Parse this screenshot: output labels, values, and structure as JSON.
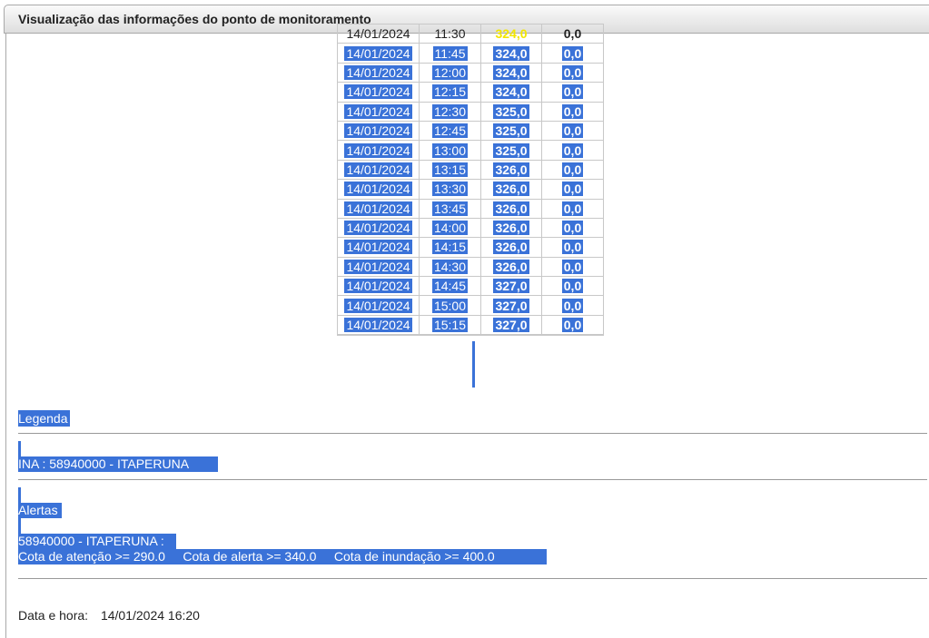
{
  "window": {
    "title": "Visualização das informações do ponto de monitoramento"
  },
  "readings": [
    {
      "date": "14/01/2024",
      "time": "11:30",
      "cota": "324,0",
      "vazao": "0,0",
      "selected": false
    },
    {
      "date": "14/01/2024",
      "time": "11:45",
      "cota": "324,0",
      "vazao": "0,0",
      "selected": true
    },
    {
      "date": "14/01/2024",
      "time": "12:00",
      "cota": "324,0",
      "vazao": "0,0",
      "selected": true
    },
    {
      "date": "14/01/2024",
      "time": "12:15",
      "cota": "324,0",
      "vazao": "0,0",
      "selected": true
    },
    {
      "date": "14/01/2024",
      "time": "12:30",
      "cota": "325,0",
      "vazao": "0,0",
      "selected": true
    },
    {
      "date": "14/01/2024",
      "time": "12:45",
      "cota": "325,0",
      "vazao": "0,0",
      "selected": true
    },
    {
      "date": "14/01/2024",
      "time": "13:00",
      "cota": "325,0",
      "vazao": "0,0",
      "selected": true
    },
    {
      "date": "14/01/2024",
      "time": "13:15",
      "cota": "326,0",
      "vazao": "0,0",
      "selected": true
    },
    {
      "date": "14/01/2024",
      "time": "13:30",
      "cota": "326,0",
      "vazao": "0,0",
      "selected": true
    },
    {
      "date": "14/01/2024",
      "time": "13:45",
      "cota": "326,0",
      "vazao": "0,0",
      "selected": true
    },
    {
      "date": "14/01/2024",
      "time": "14:00",
      "cota": "326,0",
      "vazao": "0,0",
      "selected": true
    },
    {
      "date": "14/01/2024",
      "time": "14:15",
      "cota": "326,0",
      "vazao": "0,0",
      "selected": true
    },
    {
      "date": "14/01/2024",
      "time": "14:30",
      "cota": "326,0",
      "vazao": "0,0",
      "selected": true
    },
    {
      "date": "14/01/2024",
      "time": "14:45",
      "cota": "327,0",
      "vazao": "0,0",
      "selected": true
    },
    {
      "date": "14/01/2024",
      "time": "15:00",
      "cota": "327,0",
      "vazao": "0,0",
      "selected": true
    },
    {
      "date": "14/01/2024",
      "time": "15:15",
      "cota": "327,0",
      "vazao": "0,0",
      "selected": true
    }
  ],
  "legend": {
    "heading": "Legenda",
    "station": "INA : 58940000 - ITAPERUNA",
    "alerts_heading": "Alertas",
    "alerts_station": "58940000 - ITAPERUNA :",
    "alerts_levels": "Cota de atenção >= 290.0     Cota de alerta >= 340.0     Cota de inundação >= 400.0"
  },
  "footer": {
    "label": "Data e hora:",
    "value": "14/01/2024 16:20"
  },
  "colors": {
    "selection": "#3a72d8",
    "first_row_cota": "#f2e600"
  }
}
